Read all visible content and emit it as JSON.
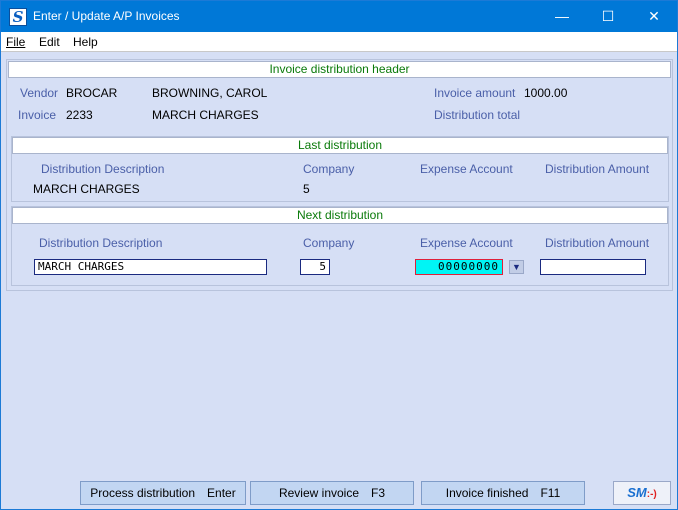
{
  "window": {
    "title": "Enter / Update A/P Invoices",
    "icon_letter": "S",
    "minimize_glyph": "—",
    "maximize_glyph": "☐",
    "close_glyph": "✕"
  },
  "menu": {
    "file": "File",
    "edit": "Edit",
    "help": "Help"
  },
  "header": {
    "section_title": "Invoice distribution header",
    "vendor_label": "Vendor",
    "vendor_code": "BROCAR",
    "vendor_name": "BROWNING, CAROL",
    "invoice_label": "Invoice",
    "invoice_number": "2233",
    "invoice_description": "MARCH CHARGES",
    "invoice_amount_label": "Invoice amount",
    "invoice_amount": "1000.00",
    "distribution_total_label": "Distribution total",
    "distribution_total": ""
  },
  "last_distribution": {
    "section_title": "Last distribution",
    "col_description": "Distribution Description",
    "col_company": "Company",
    "col_expense": "Expense Account",
    "col_amount": "Distribution Amount",
    "description": "MARCH CHARGES",
    "company": "5",
    "expense_account": "",
    "amount": ""
  },
  "next_distribution": {
    "section_title": "Next distribution",
    "col_description": "Distribution Description",
    "col_company": "Company",
    "col_expense": "Expense Account",
    "col_amount": "Distribution Amount",
    "description_value": "MARCH CHARGES",
    "company_value": "5",
    "expense_account_value": "00000000",
    "amount_value": ""
  },
  "buttons": {
    "process_label": "Process distribution",
    "process_key": "Enter",
    "review_label": "Review invoice",
    "review_key": "F3",
    "finished_label": "Invoice finished",
    "finished_key": "F11"
  },
  "logo": {
    "text": "SM",
    "smile": ":-)"
  }
}
